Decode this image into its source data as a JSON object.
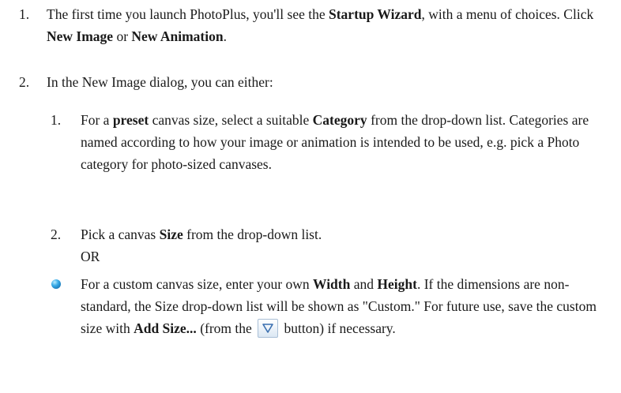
{
  "steps": [
    {
      "number": "1.",
      "parts": [
        "The first time you launch PhotoPlus, you'll see the ",
        "Startup Wizard",
        ", with a menu of choices. Click ",
        "New Image",
        " or ",
        "New Animation",
        "."
      ]
    },
    {
      "number": "2.",
      "parts": [
        "In the New Image dialog, you can either:"
      ]
    }
  ],
  "substeps": [
    {
      "number": "1.",
      "parts": [
        "For a ",
        "preset",
        " canvas size, select a suitable ",
        "Category",
        " from the drop-down list. Categories are named according to how your image or animation is intended to be used, e.g. pick a Photo category for photo-sized canvases."
      ]
    },
    {
      "number": "2.",
      "parts": [
        "Pick a canvas ",
        "Size",
        " from the drop-down list."
      ],
      "or_label": "OR"
    }
  ],
  "bullet": {
    "icon": "blue-sphere-bullet-icon",
    "parts": [
      "For a custom canvas size, enter your own ",
      "Width",
      " and ",
      "Height",
      ". If the dimensions are non-standard, the Size drop-down list will be shown as \"Custom.\" For future use, save the custom size with ",
      "Add Size...",
      " (from the "
    ],
    "button_icon": "triangle-down-icon",
    "trailing_text": " button) if necessary."
  },
  "colors": {
    "text": "#1a1a1a",
    "bullet": "#36a9e6",
    "button_border": "#a9bfd6",
    "triangle": "#3a6fb0"
  }
}
